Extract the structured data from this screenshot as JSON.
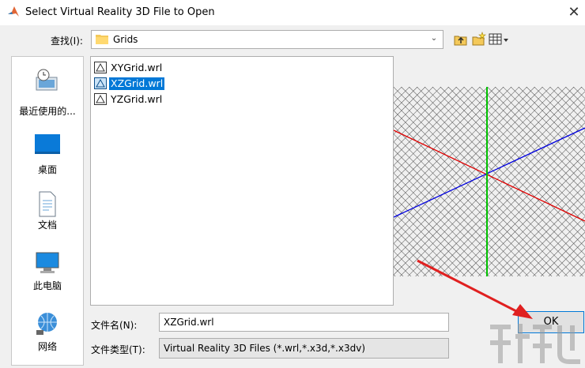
{
  "window": {
    "title": "Select Virtual Reality 3D File to Open",
    "close_glyph": "✕"
  },
  "lookin": {
    "label": "查找(I):",
    "value": "Grids",
    "arrow_glyph": "⌄"
  },
  "places": [
    {
      "label": "最近使用的...",
      "icon": "recent-places-icon"
    },
    {
      "label": "桌面",
      "icon": "desktop-icon"
    },
    {
      "label": "文档",
      "icon": "documents-icon"
    },
    {
      "label": "此电脑",
      "icon": "this-pc-icon"
    },
    {
      "label": "网络",
      "icon": "network-icon"
    }
  ],
  "files": [
    {
      "name": "XYGrid.wrl",
      "selected": false
    },
    {
      "name": "XZGrid.wrl",
      "selected": true
    },
    {
      "name": "YZGrid.wrl",
      "selected": false
    }
  ],
  "filename": {
    "label": "文件名(N):",
    "value": "XZGrid.wrl"
  },
  "filetype": {
    "label": "文件类型(T):",
    "value": "Virtual Reality 3D Files (*.wrl,*.x3d,*.x3dv)"
  },
  "ok_label": "OK",
  "colors": {
    "selection": "#0078d7",
    "annotation_arrow": "#e02020",
    "axis_x": "#e00000",
    "axis_y": "#00c000",
    "axis_z": "#0000e0"
  }
}
